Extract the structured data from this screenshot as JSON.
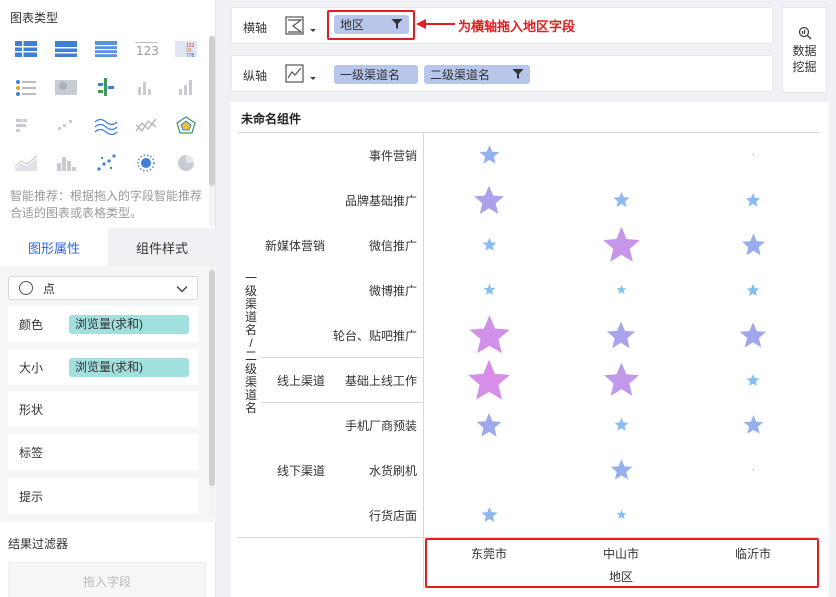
{
  "left_panel": {
    "chart_types_title": "图表类型",
    "chart_types": [
      "table-icon",
      "cross-table-icon",
      "detail-table-icon",
      "number-card-icon",
      "color-table-icon",
      "metric-list-icon",
      "heatmap-icon",
      "dot-cluster-icon",
      "column-icon",
      "bar-icon",
      "grouped-bar-icon",
      "scatter-icon",
      "wave-icon",
      "range-icon",
      "radar-icon",
      "area-icon",
      "histogram-icon",
      "point-icon",
      "bubble-icon",
      "pie-icon"
    ],
    "tip": "智能推荐：根据拖入的字段智能推荐合适的图表或表格类型。",
    "tabs": {
      "graph_props": "图形属性",
      "component_style": "组件样式"
    },
    "mark_type": "点",
    "props": {
      "color_label": "颜色",
      "color_field": "浏览量(求和)",
      "size_label": "大小",
      "size_field": "浏览量(求和)",
      "shape_label": "形状",
      "label_label": "标签",
      "tooltip_label": "提示"
    },
    "filter_title": "结果过滤器",
    "drop_placeholder": "拖入字段"
  },
  "axes": {
    "x_label": "横轴",
    "x_field": "地区",
    "y_label": "纵轴",
    "y_field1": "一级渠道名",
    "y_field2": "二级渠道名",
    "annotation": "为横轴拖入地区字段",
    "mining_line1": "数据",
    "mining_line2": "挖掘"
  },
  "chart_data": {
    "type": "scatter",
    "title": "未命名组件",
    "ylabel": "一级渠道名/二级渠道名",
    "xlabel": "地区",
    "categories": [
      "东莞市",
      "中山市",
      "临沂市"
    ],
    "groups": [
      {
        "name": "新媒体营销",
        "items": [
          "事件营销",
          "品牌基础推广",
          "微信推广",
          "微博推广",
          "轮台、贴吧推广"
        ]
      },
      {
        "name": "线上渠道",
        "items": [
          "基础上线工作"
        ]
      },
      {
        "name": "线下渠道",
        "items": [
          "手机厂商预装",
          "水货刷机",
          "行货店面"
        ]
      }
    ],
    "rows": [
      "事件营销",
      "品牌基础推广",
      "微信推广",
      "微博推广",
      "轮台、贴吧推广",
      "基础上线工作",
      "手机厂商预装",
      "水货刷机",
      "行货店面"
    ],
    "values": [
      [
        0.35,
        null,
        0.02
      ],
      [
        0.65,
        0.25,
        0.2
      ],
      [
        0.18,
        0.85,
        0.45
      ],
      [
        0.12,
        0.06,
        0.15
      ],
      [
        0.95,
        0.6,
        0.55
      ],
      [
        1.0,
        0.8,
        0.15
      ],
      [
        0.5,
        0.18,
        0.35
      ],
      [
        null,
        0.4,
        0.02
      ],
      [
        0.25,
        0.06,
        null
      ]
    ],
    "color_scale": [
      "#7ec8f0",
      "#9ca9ec",
      "#d88ee8"
    ]
  }
}
